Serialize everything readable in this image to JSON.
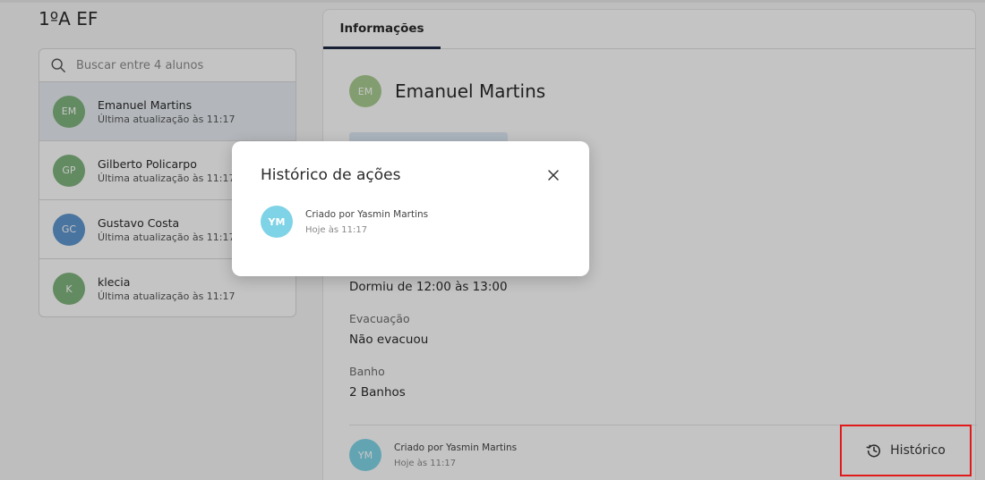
{
  "class_title": "1ºA EF",
  "search": {
    "placeholder": "Buscar entre 4 alunos"
  },
  "students": [
    {
      "initials": "EM",
      "name": "Emanuel Martins",
      "updated": "Última atualização às 11:17",
      "color": "#7fb27d",
      "active": true
    },
    {
      "initials": "GP",
      "name": "Gilberto Policarpo",
      "updated": "Última atualização às 11:17",
      "color": "#7fb27d",
      "active": false
    },
    {
      "initials": "GC",
      "name": "Gustavo Costa",
      "updated": "Última atualização às 11:17",
      "color": "#5e95cc",
      "active": false
    },
    {
      "initials": "K",
      "name": "klecia",
      "updated": "Última atualização às 11:17",
      "color": "#7fb27d",
      "active": false
    }
  ],
  "tabs": [
    {
      "label": "Informações",
      "active": true
    }
  ],
  "detail": {
    "initials": "EM",
    "avatar_color": "#a7c98f",
    "name": "Emanuel Martins",
    "sleep_value": "Dormiu de 12:00 às 13:00",
    "evacuation_label": "Evacuação",
    "evacuation_value": "Não evacuou",
    "bath_label": "Banho",
    "bath_value": "2 Banhos",
    "footer_initials": "YM",
    "footer_creator": "Criado por Yasmin Martins",
    "footer_when": "Hoje às 11:17"
  },
  "history_button": {
    "label": "Histórico",
    "icon": "history-icon"
  },
  "modal": {
    "title": "Histórico de ações",
    "entries": [
      {
        "initials": "YM",
        "creator": "Criado por Yasmin Martins",
        "when": "Hoje às 11:17",
        "color": "#7fd3e6"
      }
    ]
  },
  "colors": {
    "highlight_border": "#e01a1a",
    "tab_underline": "#1e2a45"
  }
}
